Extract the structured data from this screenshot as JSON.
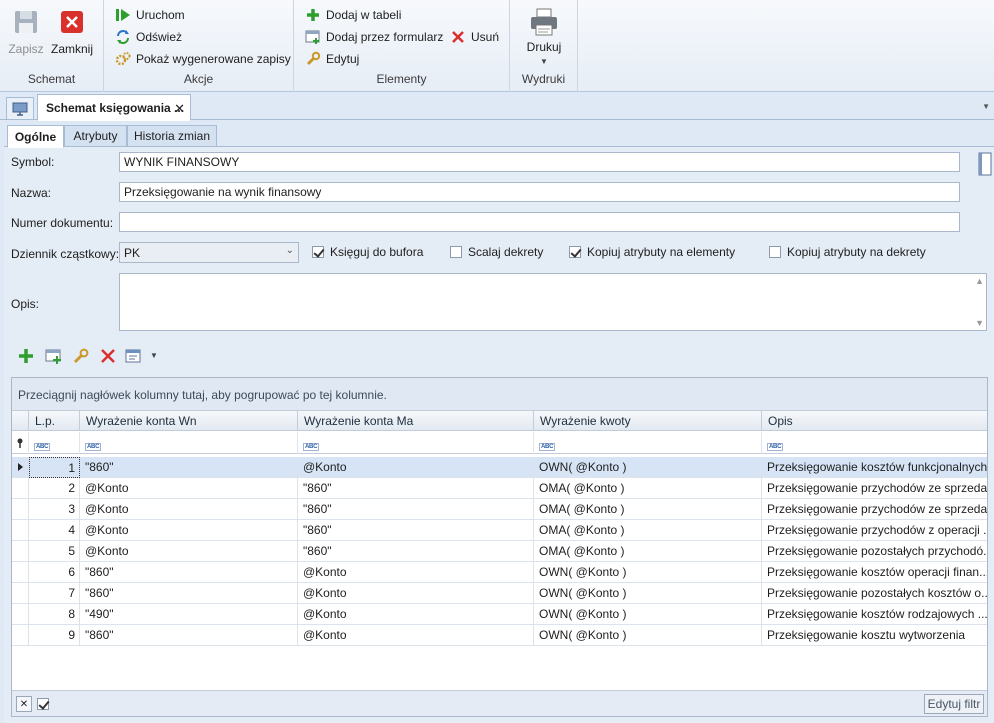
{
  "ribbon": {
    "schemat": {
      "label": "Schemat",
      "save": "Zapisz",
      "close": "Zamknij"
    },
    "akcje": {
      "label": "Akcje",
      "run": "Uruchom",
      "refresh": "Odśwież",
      "show_generated": "Pokaż wygenerowane zapisy"
    },
    "elementy": {
      "label": "Elementy",
      "add_table": "Dodaj w tabeli",
      "add_form": "Dodaj przez formularz",
      "edit": "Edytuj",
      "delete": "Usuń"
    },
    "wydruki": {
      "label": "Wydruki",
      "print": "Drukuj"
    }
  },
  "document_tab": {
    "title": "Schemat księgowania ...",
    "close": "✕"
  },
  "tabs": [
    "Ogólne",
    "Atrybuty",
    "Historia zmian"
  ],
  "form": {
    "symbol_label": "Symbol:",
    "symbol_value": "WYNIK FINANSOWY",
    "name_label": "Nazwa:",
    "name_value": "Przeksięgowanie na wynik finansowy",
    "docnum_label": "Numer dokumentu:",
    "docnum_value": "",
    "journal_label": "Dziennik cząstkowy:",
    "journal_value": "PK",
    "opis_label": "Opis:",
    "opis_value": "",
    "checkboxes": [
      {
        "label": "Księguj do bufora",
        "checked": true
      },
      {
        "label": "Scalaj dekrety",
        "checked": false
      },
      {
        "label": "Kopiuj atrybuty na elementy",
        "checked": true
      },
      {
        "label": "Kopiuj atrybuty na dekrety",
        "checked": false
      }
    ]
  },
  "grid": {
    "group_hint": "Przeciągnij nagłówek kolumny tutaj, aby pogrupować po tej kolumnie.",
    "columns": [
      "L.p.",
      "Wyrażenie konta Wn",
      "Wyrażenie konta Ma",
      "Wyrażenie kwoty",
      "Opis"
    ],
    "filter_marker": "ABC",
    "rows": [
      [
        "1",
        "\"860\"",
        "@Konto",
        "OWN( @Konto )",
        "Przeksięgowanie kosztów funkcjonalnych"
      ],
      [
        "2",
        "@Konto",
        "\"860\"",
        "OMA( @Konto )",
        "Przeksięgowanie przychodów ze sprzeda..."
      ],
      [
        "3",
        "@Konto",
        "\"860\"",
        "OMA( @Konto )",
        "Przeksięgowanie przychodów ze sprzeda..."
      ],
      [
        "4",
        "@Konto",
        "\"860\"",
        "OMA( @Konto )",
        "Przeksięgowanie przychodów z operacji ..."
      ],
      [
        "5",
        "@Konto",
        "\"860\"",
        "OMA( @Konto )",
        "Przeksięgowanie pozostałych przychodó..."
      ],
      [
        "6",
        "\"860\"",
        "@Konto",
        "OWN( @Konto )",
        "Przeksięgowanie kosztów operacji finan..."
      ],
      [
        "7",
        "\"860\"",
        "@Konto",
        "OWN( @Konto )",
        "Przeksięgowanie pozostałych kosztów o..."
      ],
      [
        "8",
        "\"490\"",
        "@Konto",
        "OWN( @Konto )",
        "Przeksięgowanie kosztów rodzajowych ..."
      ],
      [
        "9",
        "\"860\"",
        "@Konto",
        "OWN( @Konto )",
        "Przeksięgowanie kosztu wytworzenia"
      ]
    ],
    "edit_filter": "Edytuj filtr"
  },
  "colors": {
    "accent_green": "#2e9e2e",
    "delete_red": "#d9302c",
    "selection": "#d6e4f5"
  }
}
